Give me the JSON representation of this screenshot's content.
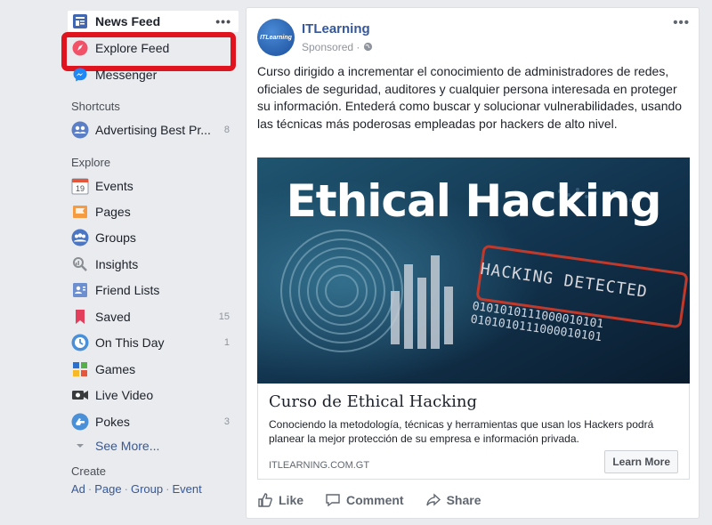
{
  "sidebar": {
    "news_feed": "News Feed",
    "news_feed_menu": "•••",
    "explore_feed": "Explore Feed",
    "messenger": "Messenger",
    "shortcuts_label": "Shortcuts",
    "shortcuts": [
      {
        "label": "Advertising Best Pr...",
        "count": "8",
        "icon": "group-icon"
      }
    ],
    "explore_label": "Explore",
    "explore_items": [
      {
        "label": "Events",
        "count": "",
        "icon": "calendar-icon",
        "icon_text": "19"
      },
      {
        "label": "Pages",
        "count": "",
        "icon": "flag-icon"
      },
      {
        "label": "Groups",
        "count": "",
        "icon": "groups-icon"
      },
      {
        "label": "Insights",
        "count": "",
        "icon": "insights-icon"
      },
      {
        "label": "Friend Lists",
        "count": "",
        "icon": "friend-lists-icon"
      },
      {
        "label": "Saved",
        "count": "15",
        "icon": "bookmark-icon"
      },
      {
        "label": "On This Day",
        "count": "1",
        "icon": "clock-icon"
      },
      {
        "label": "Games",
        "count": "",
        "icon": "games-icon"
      },
      {
        "label": "Live Video",
        "count": "",
        "icon": "video-camera-icon"
      },
      {
        "label": "Pokes",
        "count": "3",
        "icon": "poke-icon"
      }
    ],
    "see_more": "See More...",
    "create_label": "Create",
    "create_links": [
      "Ad",
      "Page",
      "Group",
      "Event"
    ],
    "create_separator": "·"
  },
  "post": {
    "page_name": "ITLearning",
    "avatar_text": "ITLearning",
    "sponsored": "Sponsored ·",
    "menu": "•••",
    "text": "Curso dirigido a incrementar el conocimiento de administradores de redes, oficiales de seguridad, auditores y cualquier persona interesada en proteger su información. Entederá como buscar y solucionar vulnerabilidades, usando las técnicas más poderosas empleadas por hackers de alto nivel.",
    "image": {
      "title": "Ethical Hacking",
      "detected": "HACKING DETECTED",
      "binary": "0101010111000010101\n0101010111000010101"
    },
    "link": {
      "title": "Curso de Ethical Hacking",
      "description": "Conociendo la metodología, técnicas y herramientas que usan los Hackers podrá planear la mejor protección de su empresa e información privada.",
      "domain": "ITLEARNING.COM.GT",
      "cta": "Learn More"
    },
    "actions": {
      "like": "Like",
      "comment": "Comment",
      "share": "Share"
    }
  },
  "colors": {
    "highlight": "#e0141e",
    "link_blue": "#365899",
    "background": "#e9ebee"
  }
}
